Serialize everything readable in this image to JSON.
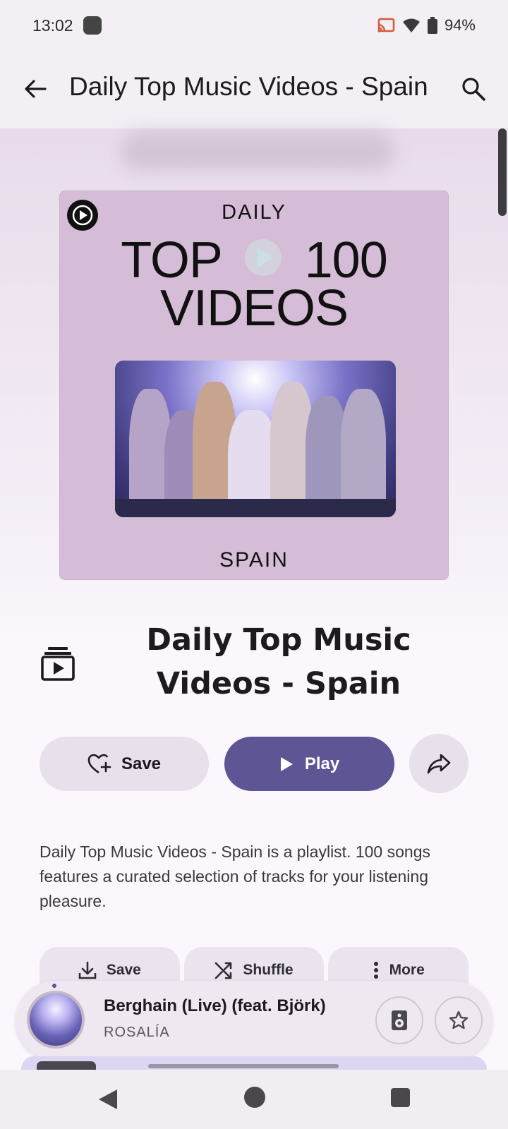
{
  "status_bar": {
    "time": "13:02",
    "battery": "94%"
  },
  "app_bar": {
    "title": "Daily Top Music Videos - Spain"
  },
  "cover": {
    "daily": "DAILY",
    "top_left": "TOP",
    "top_right": "100",
    "line2": "VIDEOS",
    "country": "SPAIN"
  },
  "playlist": {
    "title": "Daily Top Music Videos - Spain",
    "description": "Daily Top Music Videos - Spain is a playlist. 100 songs features a curated selection of tracks for your listening pleasure."
  },
  "actions": {
    "save_label": "Save",
    "play_label": "Play"
  },
  "chips": [
    {
      "label": "Save",
      "icon": "download-icon"
    },
    {
      "label": "Shuffle",
      "icon": "shuffle-icon"
    },
    {
      "label": "More",
      "icon": "more-vert-icon"
    }
  ],
  "now_playing": {
    "track": "Berghain (Live) (feat. Björk)",
    "artist": "ROSALÍA"
  },
  "colors": {
    "accent": "#5e5594",
    "surface": "#fbf7fc",
    "cover_bg": "#d6bdd7"
  }
}
